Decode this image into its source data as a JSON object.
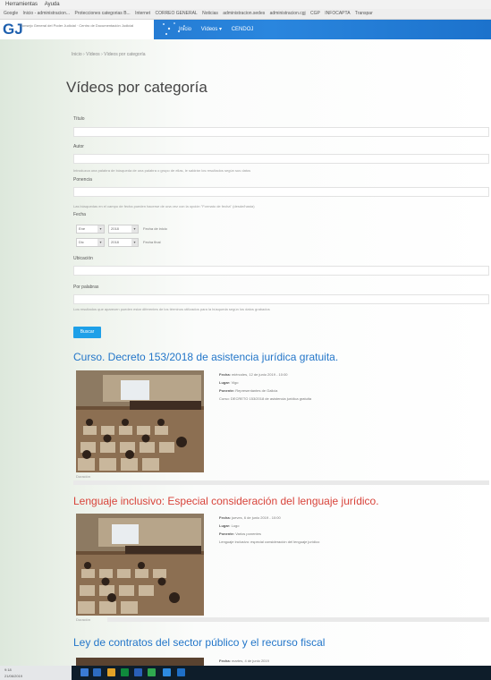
{
  "browser": {
    "menu": [
      "Herramientas",
      "Ayuda"
    ],
    "bookmarks": [
      "Google",
      "Inicio - administracion...",
      "Protecciones categorias B...",
      "Internet",
      "CORREO GENERAL",
      "Noticias",
      "administracion.sedes",
      "administracion.cgj",
      "CGP",
      "INFOCAPTA",
      "Transpar"
    ]
  },
  "site": {
    "logo_mark": "GJ",
    "logo_text": "Consejo General del Poder Judicial · Centro de Documentación Judicial",
    "nav": [
      "Inicio",
      "Vídeos ▾",
      "CENDOJ"
    ]
  },
  "breadcrumb": "Inicio › Vídeos › Vídeos por categoría",
  "page": {
    "title": "Vídeos por categoría"
  },
  "form": {
    "f1_label": "Título",
    "f2_label": "Autor",
    "help1": "Introduzca una palabra de búsqueda de una palabra o grupo de ellas, le saldrán los resultados según sus datos",
    "f3_label": "Ponencia",
    "help2": "Las búsquedas en el campo de fecha pueden hacerse de una vez con la opción \"Formato de fecha\" (desde/hasta)",
    "date_label": "Fecha",
    "date_from": {
      "day": "Ene",
      "year": "2018",
      "caption": "Fecha de inicio"
    },
    "date_to": {
      "day": "Dic",
      "year": "2018",
      "caption": "Fecha final"
    },
    "f4_label": "Ubicación",
    "f5_label": "Por palabras",
    "help3": "Los resultados que aparecen pueden estar diferentes de los términos utilizados para la búsqueda según los datos grabados",
    "search_label": "Buscar"
  },
  "videos": [
    {
      "title": "Curso. Decreto 153/2018 de asistencia jurídica gratuita.",
      "color": "#2376c9",
      "meta": [
        {
          "k": "Fecha:",
          "v": "miércoles, 12 de junio 2019 - 10:00"
        },
        {
          "k": "Lugar:",
          "v": "Vigo"
        },
        {
          "k": "Ponente:",
          "v": "Representantes de Galicia"
        },
        {
          "k": "",
          "v": "Curso: DECRETO 153/2018 de asistencia jurídica gratuita"
        }
      ],
      "caption": "Duración"
    },
    {
      "title": "Lenguaje inclusivo: Especial consideración del lenguaje jurídico.",
      "color": "#d8433a",
      "meta": [
        {
          "k": "Fecha:",
          "v": "jueves, 6 de junio 2019 - 10:00"
        },
        {
          "k": "Lugar:",
          "v": "Lugo"
        },
        {
          "k": "Ponente:",
          "v": "Varios ponentes"
        },
        {
          "k": "",
          "v": "Lenguaje inclusivo: especial consideración del lenguaje jurídico"
        }
      ],
      "caption": "Duración"
    },
    {
      "title": "Ley de contratos del sector público y el recurso fiscal",
      "color": "#2376c9",
      "meta": [
        {
          "k": "Fecha:",
          "v": "martes, 4 de junio 2019"
        }
      ],
      "caption": ""
    }
  ],
  "taskbar": {
    "time": "9:18",
    "date": "21/06/2019"
  },
  "colors": {
    "header": "#1f6fc6",
    "link": "#2376c9",
    "link_alt": "#d8433a",
    "button": "#1ea0e8"
  }
}
